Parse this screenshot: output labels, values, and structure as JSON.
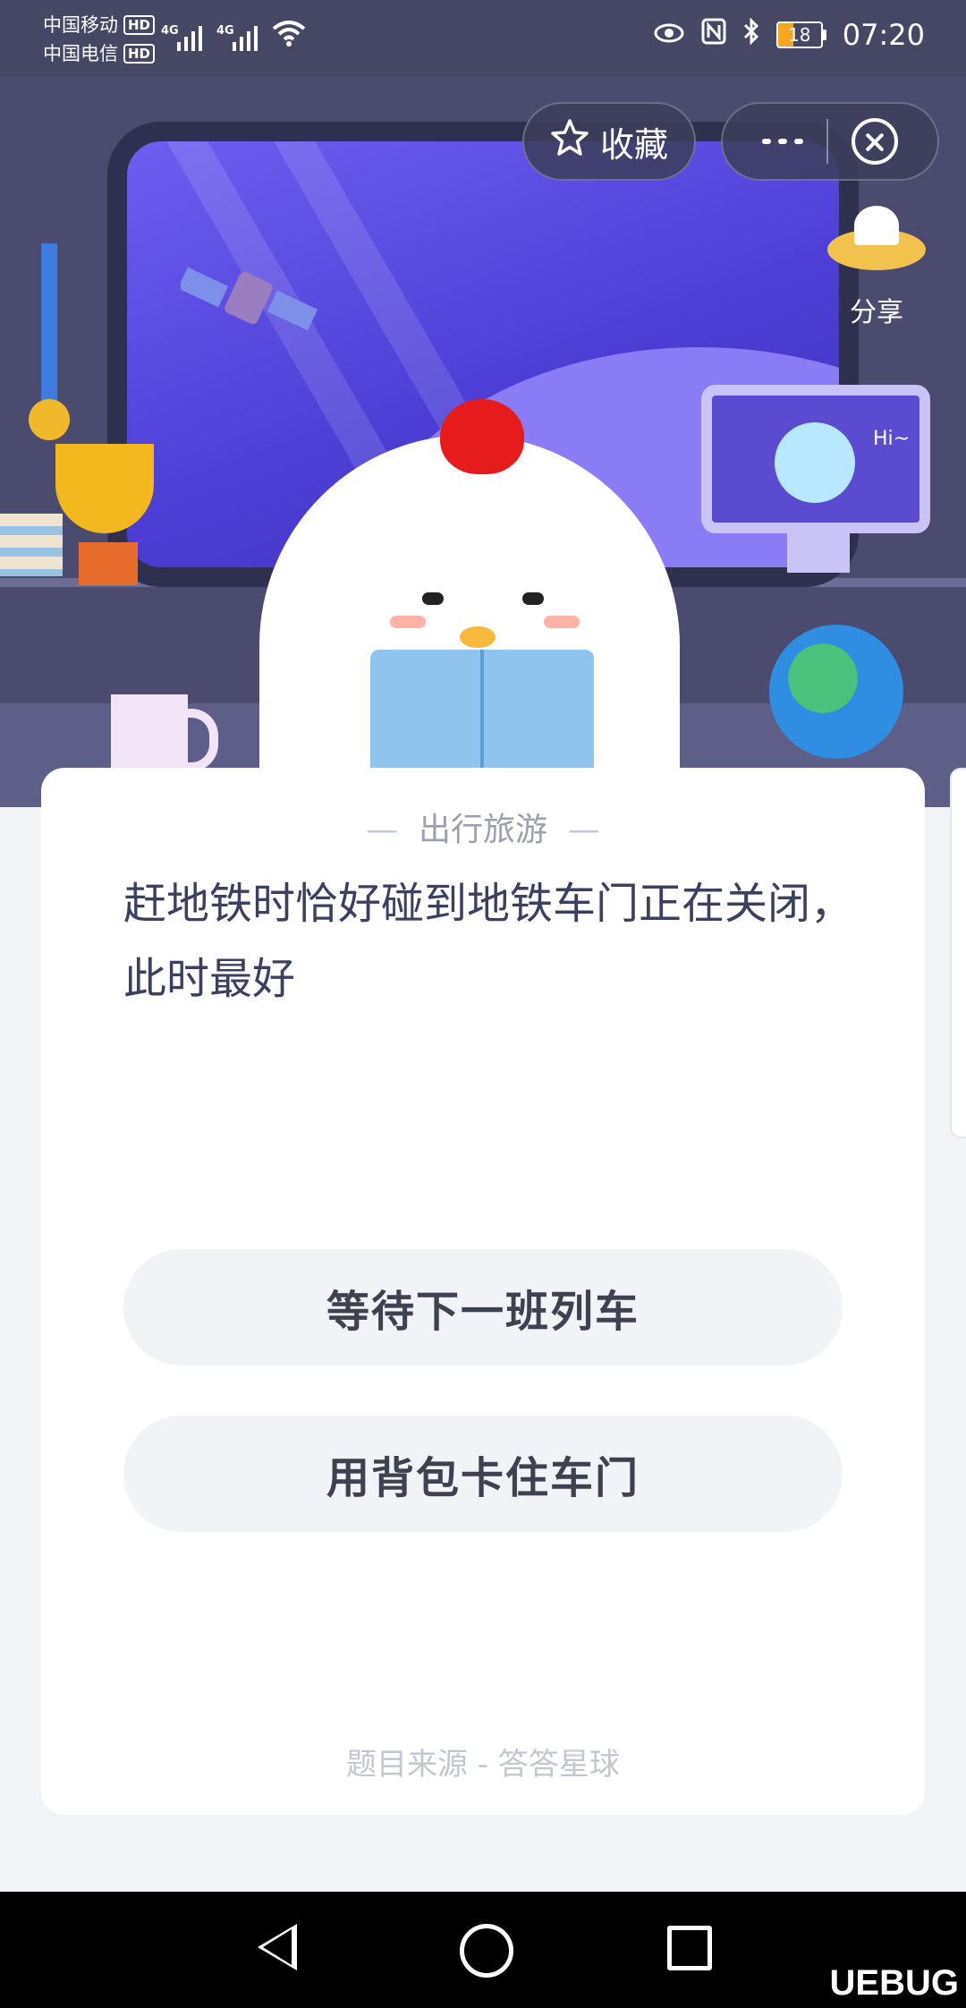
{
  "status_bar": {
    "carrier1": "中国移动",
    "carrier2": "中国电信",
    "hd_badge": "HD",
    "network": "4G",
    "battery_level": "18",
    "time": "07:20"
  },
  "header": {
    "favorite_label": "收藏",
    "share_label": "分享"
  },
  "scene": {
    "monitor_text": "Hi~"
  },
  "question_card": {
    "category": "出行旅游",
    "question": "赶地铁时恰好碰到地铁车门正在关闭，此时最好",
    "options": [
      "等待下一班列车",
      "用背包卡住车门"
    ],
    "source": "题目来源 - 答答星球"
  },
  "watermark": "UEBUG"
}
